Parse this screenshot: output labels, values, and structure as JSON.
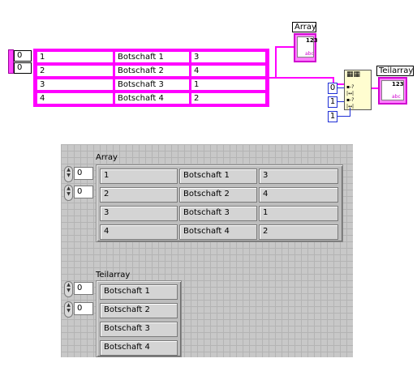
{
  "block_diagram": {
    "index_values": [
      "0",
      "0"
    ],
    "rows": [
      [
        "1",
        "Botschaft 1",
        "3"
      ],
      [
        "2",
        "Botschaft 2",
        "4"
      ],
      [
        "3",
        "Botschaft 3",
        "1"
      ],
      [
        "4",
        "Botschaft 4",
        "2"
      ]
    ],
    "array_terminal_label": "Array",
    "subarray_terminal_label": "Teilarray",
    "terminal_glyph": "123",
    "terminal_sub_glyph": "abc",
    "constants": [
      "0",
      "1",
      "1"
    ],
    "wire_colors": {
      "cluster": "#ff00ff",
      "numeric": "#1f2fd6"
    }
  },
  "front_panel": {
    "array": {
      "label": "Array",
      "index_values": [
        "0",
        "0"
      ],
      "rows": [
        [
          "1",
          "Botschaft 1",
          "3"
        ],
        [
          "2",
          "Botschaft 2",
          "4"
        ],
        [
          "3",
          "Botschaft 3",
          "1"
        ],
        [
          "4",
          "Botschaft 4",
          "2"
        ]
      ]
    },
    "teilarray": {
      "label": "Teilarray",
      "index_values": [
        "0",
        "0"
      ],
      "rows": [
        "Botschaft 1",
        "Botschaft 2",
        "Botschaft 3",
        "Botschaft 4"
      ]
    }
  }
}
